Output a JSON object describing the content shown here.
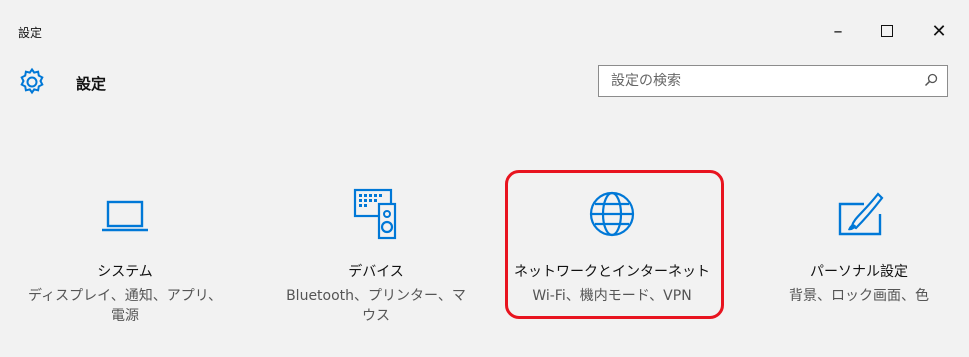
{
  "window": {
    "title": "設定",
    "controls": {
      "minimize": "–",
      "maximize": "maximize",
      "close": "✕"
    }
  },
  "header": {
    "title": "設定",
    "icon": "gear-icon"
  },
  "search": {
    "placeholder": "設定の検索",
    "icon": "search-icon"
  },
  "tiles": [
    {
      "id": "system",
      "icon": "laptop-icon",
      "name": "システム",
      "desc": "ディスプレイ、通知、アプリ、\n電源"
    },
    {
      "id": "devices",
      "icon": "devices-icon",
      "name": "デバイス",
      "desc": "Bluetooth、プリンター、マ\nウス"
    },
    {
      "id": "network",
      "icon": "globe-icon",
      "name": "ネットワークとインターネット",
      "desc": "Wi-Fi、機内モード、VPN"
    },
    {
      "id": "personalization",
      "icon": "paint-icon",
      "name": "パーソナル設定",
      "desc": "背景、ロック画面、色"
    }
  ],
  "colors": {
    "accent": "#0078d7",
    "highlight": "#e8141f",
    "background": "#f2f2f2"
  }
}
